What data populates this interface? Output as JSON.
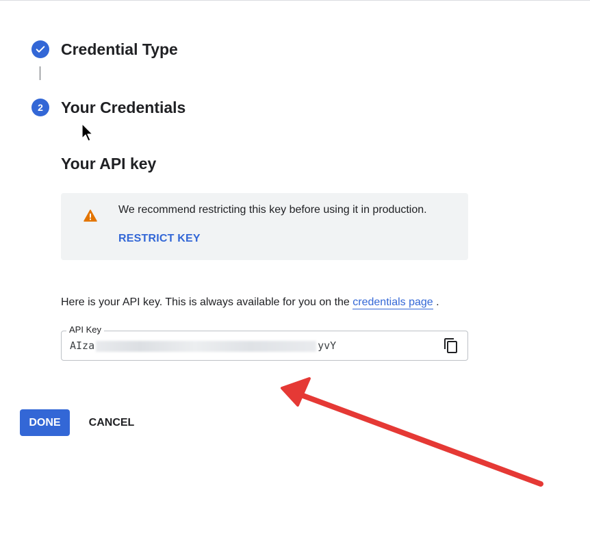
{
  "stepper": {
    "steps": [
      {
        "status": "completed",
        "icon": "check-icon",
        "title": "Credential Type"
      },
      {
        "status": "active",
        "number": "2",
        "title": "Your Credentials"
      }
    ]
  },
  "api_key_section": {
    "title": "Your API key",
    "warning": {
      "icon": "warning-icon",
      "text": "We recommend restricting this key before using it in production.",
      "action_label": "RESTRICT KEY"
    },
    "info": {
      "text_before": "Here is your API key. This is always available for you on the ",
      "link_text": "credentials page",
      "text_after": " ."
    },
    "key_field": {
      "label": "API Key",
      "value_prefix": "AIza",
      "value_suffix": "yvY",
      "value_masked": true,
      "copy_icon": "copy-icon"
    }
  },
  "actions": {
    "done_label": "DONE",
    "cancel_label": "CANCEL"
  },
  "colors": {
    "accent": "#3367d6",
    "warning": "#e37400",
    "annotation_arrow": "#e53935",
    "panel_bg": "#f1f3f4"
  }
}
